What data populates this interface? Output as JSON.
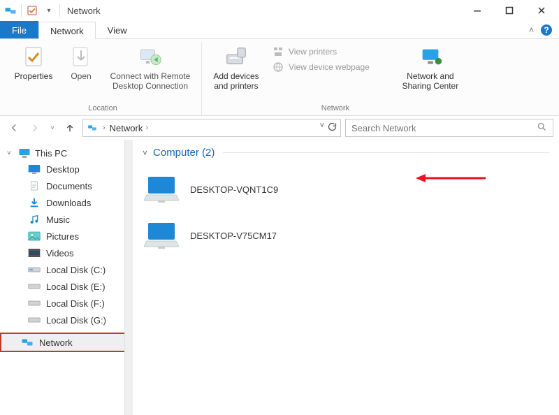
{
  "window": {
    "title": "Network"
  },
  "tabs": {
    "file": "File",
    "network": "Network",
    "view": "View"
  },
  "ribbon": {
    "location": {
      "label": "Location",
      "properties": "Properties",
      "open": "Open",
      "remote": "Connect with Remote\nDesktop Connection"
    },
    "network": {
      "label": "Network",
      "add_devices": "Add devices\nand printers",
      "view_printers": "View printers",
      "view_webpage": "View device webpage",
      "sharing": "Network and\nSharing Center"
    }
  },
  "address": {
    "crumb": "Network"
  },
  "search": {
    "placeholder": "Search Network"
  },
  "navpane": {
    "this_pc": "This PC",
    "items": [
      "Desktop",
      "Documents",
      "Downloads",
      "Music",
      "Pictures",
      "Videos",
      "Local Disk (C:)",
      "Local Disk (E:)",
      "Local Disk (F:)",
      "Local Disk (G:)"
    ],
    "network": "Network"
  },
  "section": {
    "title": "Computer (2)",
    "computers": [
      {
        "name": "DESKTOP-VQNT1C9"
      },
      {
        "name": "DESKTOP-V75CM17"
      }
    ]
  }
}
